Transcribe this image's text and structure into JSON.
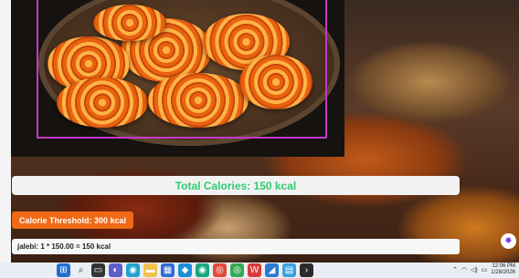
{
  "result": {
    "total_calories": "Total Calories: 150 kcal",
    "threshold": "Calorie Threshold: 300 kcal",
    "item_line": "jalebi: 1 * 150.00 = 150 kcal"
  },
  "photo": {
    "subject_icon": "jalebi-plate"
  },
  "colors": {
    "total_text": "#2ecc71",
    "threshold_bg": "#f06a16",
    "selection_border": "#c43ac4"
  },
  "taskbar": {
    "icons": [
      "windows-start-icon",
      "search-icon",
      "task-view-icon",
      "chat-icon",
      "edge-icon",
      "file-explorer-icon",
      "store-icon",
      "photos-icon",
      "edge-dev-icon",
      "chrome-icon",
      "chrome-alt-icon",
      "office-icon",
      "vs-code-icon",
      "notepad-icon",
      "terminal-icon"
    ],
    "time": "12:06 PM",
    "date": "1/28/2026"
  }
}
